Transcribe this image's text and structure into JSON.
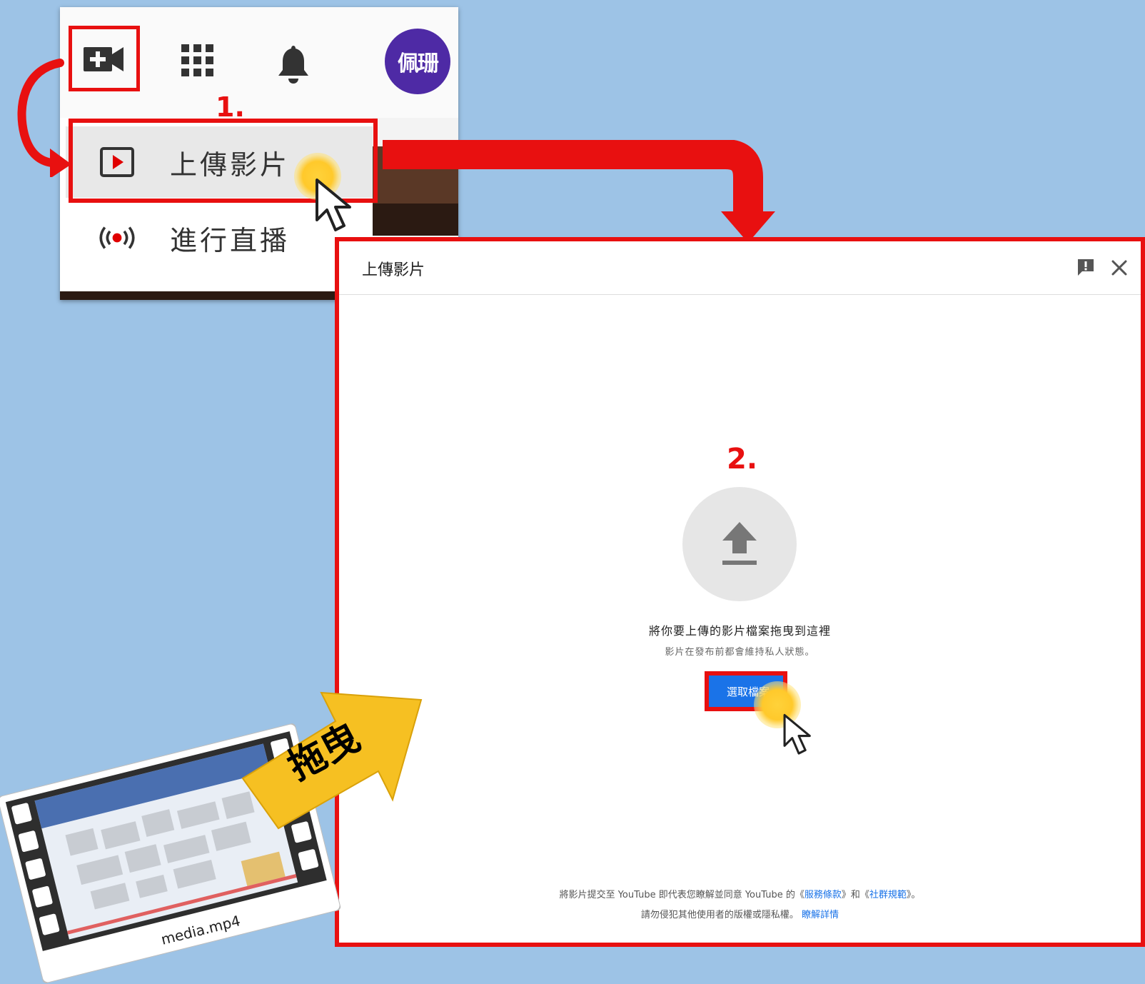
{
  "header": {
    "avatar_text": "佩珊",
    "menu": {
      "upload_label": "上傳影片",
      "live_label": "進行直播"
    }
  },
  "annotations": {
    "step1": "1.",
    "step2": "2.",
    "drag_label": "拖曳"
  },
  "dialog": {
    "title": "上傳影片",
    "drop_instruction": "將你要上傳的影片檔案拖曳到這裡",
    "privacy_note": "影片在發布前都會維持私人狀態。",
    "select_files_button": "選取檔案",
    "terms": {
      "line1_prefix": "將影片提交至 YouTube 即代表您瞭解並同意 YouTube 的《",
      "terms_of_service": "服務條款",
      "line1_mid": "》和《",
      "community_guidelines": "社群規範",
      "line1_suffix": "》。",
      "line2_prefix": "請勿侵犯其他使用者的版權或隱私權。",
      "learn_more": "瞭解詳情"
    }
  },
  "film": {
    "filename": "media.mp4"
  },
  "colors": {
    "background": "#9dc3e6",
    "annotation_red": "#e81010",
    "avatar_purple": "#4e2aa5",
    "button_blue": "#1a73e8",
    "drag_arrow_yellow": "#f6c022"
  }
}
